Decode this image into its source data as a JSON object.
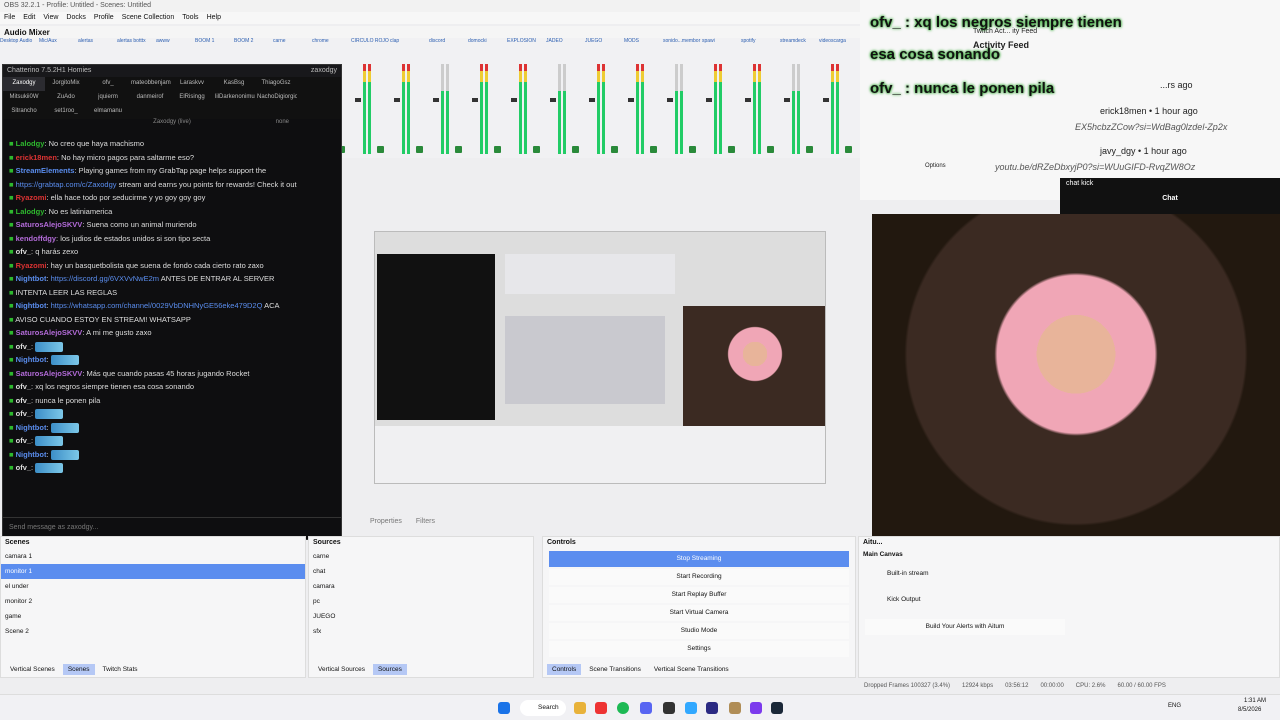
{
  "window": {
    "title": "OBS 32.2.1 - Profile: Untitled - Scenes: Untitled"
  },
  "menu": [
    "File",
    "Edit",
    "View",
    "Docks",
    "Profile",
    "Scene Collection",
    "Tools",
    "Help"
  ],
  "mixer": {
    "title": "Audio Mixer",
    "channels": [
      "Desktop Audio",
      "Mic/Aux",
      "alertas",
      "alertas botttx",
      "awww",
      "BOOM 1",
      "BOOM 2",
      "carne",
      "chrome",
      "CIRCULO ROJO",
      "clap",
      "discord",
      "domocki",
      "EXPLOSION",
      "JADEO",
      "JUEGO",
      "MODS",
      "sonido...membor",
      "spawi",
      "spotify",
      "streamdeck",
      "videoscarga"
    ]
  },
  "chat": {
    "window_title": "Chatterino 7.5.2H1 Homies",
    "channel": "zaxodgy",
    "tabs_row1": [
      "Zaxodgy",
      "JorgitoMix",
      "ofv_",
      "mateobbenjamin",
      "Laraskvv",
      "KasBsg",
      "ThiagoGsz"
    ],
    "tabs_row2": [
      "Mitsukii0W",
      "ZuAdo",
      "jquierm",
      "danmeirof",
      "ElRisingg",
      "lilDarkenonimual",
      "NachoDigiorgio"
    ],
    "tabs_row3": [
      "Sitrancho",
      "set1roo_",
      "elmamanu"
    ],
    "live_label": "Zaxodgy (live)",
    "none_label": "none",
    "messages": [
      {
        "user": "Lalodgy",
        "color": "#2eb82e",
        "text": "No creo que haya machismo"
      },
      {
        "user": "erick18men",
        "color": "#d33",
        "text": "No hay micro pagos para saltarme eso?"
      },
      {
        "user": "StreamElements",
        "color": "#5a8dee",
        "text": "Playing games from my GrabTap page helps support the"
      },
      {
        "user": "",
        "color": "#ddd",
        "text": "stream and earns you points for rewards! Check it out",
        "link": "https://grabtap.com/c/Zaxodgy"
      },
      {
        "user": "Ryazomi",
        "color": "#d33",
        "text": "ella hace todo por seducirme y yo goy goy goy"
      },
      {
        "user": "Lalodgy",
        "color": "#2eb82e",
        "text": "No es latiniamerica"
      },
      {
        "user": "SaturosAlejoSKVV",
        "color": "#b36bd9",
        "text": "Suena como un animal muriendo"
      },
      {
        "user": "kendoffdgy",
        "color": "#b36bd9",
        "text": "los judios de estados unidos si son tipo secta"
      },
      {
        "user": "ofv_",
        "color": "#ddd",
        "text": "q harás zexo"
      },
      {
        "user": "Ryazomi",
        "color": "#d33",
        "text": "hay un basquetbolista que suena de fondo cada cierto rato zaxo"
      },
      {
        "user": "Nightbot",
        "color": "#5a8dee",
        "text": "ANTES DE ENTRAR AL SERVER",
        "link": "https://discord.gg/6VXVvNwE2m"
      },
      {
        "user": "",
        "color": "#ddd",
        "text": "INTENTA LEER LAS REGLAS"
      },
      {
        "user": "Nightbot",
        "color": "#5a8dee",
        "text": "ACA",
        "link": "https://whatsapp.com/channel/0029VbDNHNyGE56eke479D2Q"
      },
      {
        "user": "",
        "color": "#ddd",
        "text": "AVISO CUANDO ESTOY EN STREAM! WHATSAPP"
      },
      {
        "user": "SaturosAlejoSKVV",
        "color": "#b36bd9",
        "text": "A mi me gusto zaxo"
      },
      {
        "user": "ofv_",
        "color": "#ddd",
        "text": "",
        "emote": true
      },
      {
        "user": "Nightbot",
        "color": "#5a8dee",
        "text": "",
        "emote": true
      },
      {
        "user": "SaturosAlejoSKVV",
        "color": "#b36bd9",
        "text": "Más que cuando pasas 45 horas jugando Rocket"
      },
      {
        "user": "ofv_",
        "color": "#ddd",
        "text": "xq los negros siempre tienen esa cosa sonando"
      },
      {
        "user": "ofv_",
        "color": "#ddd",
        "text": "nunca le ponen pila"
      },
      {
        "user": "ofv_",
        "color": "#ddd",
        "text": "",
        "emote": true
      },
      {
        "user": "Nightbot",
        "color": "#5a8dee",
        "text": "",
        "emote": true
      },
      {
        "user": "ofv_",
        "color": "#ddd",
        "text": "",
        "emote": true
      },
      {
        "user": "Nightbot",
        "color": "#5a8dee",
        "text": "",
        "emote": true
      },
      {
        "user": "ofv_",
        "color": "#ddd",
        "text": "",
        "emote": true
      }
    ],
    "input_placeholder": "Send message as zaxodgy..."
  },
  "overlay": {
    "line1": "ofv_ : xq los negros siempre tienen",
    "line2": "esa cosa sonando",
    "line3": "ofv_ : nunca le ponen pila",
    "activity_feed": "Activity Feed",
    "twitch_feed": "Twitch Act... ity Feed",
    "feed1": "erick18men • 1 hour ago",
    "feed2": "javy_dgy • 1 hour ago",
    "feed3": "EX5hcbzZCow?si=WdBag0lzdel-Zp2x",
    "feed4": "youtu.be/dRZeDbxyjP0?si=WUuGIFD-RvqZW8Oz",
    "ago": "...rs ago",
    "options": "Options"
  },
  "kick": {
    "title": "chat kick",
    "label": "Chat"
  },
  "props": {
    "properties": "Properties",
    "filters": "Filters"
  },
  "scenes": {
    "title": "Scenes",
    "items": [
      "camara 1",
      "monitor 1",
      "el under",
      "monitor 2",
      "game",
      "Scene 2"
    ],
    "selected": 1,
    "tabs": [
      "Vertical Scenes",
      "Scenes",
      "Twitch Stats"
    ]
  },
  "sources": {
    "title": "Sources",
    "items": [
      "carne",
      "chat",
      "camara",
      "pc",
      "JUEGO",
      "sfx"
    ],
    "tabs": [
      "Vertical Sources",
      "Sources"
    ]
  },
  "controls": {
    "title": "Controls",
    "buttons": [
      "Stop Streaming",
      "Start Recording",
      "Start Replay Buffer",
      "Start Virtual Camera",
      "Studio Mode",
      "Settings"
    ],
    "tabs": [
      "Controls",
      "Scene Transitions",
      "Vertical Scene Transitions"
    ]
  },
  "aitum": {
    "title": "Aitu...",
    "canvas": "Main Canvas",
    "outputs": [
      "Built-in stream",
      "Kick Output"
    ],
    "build": "Build Your Alerts with Aitum"
  },
  "status": {
    "dropped": "Dropped Frames 100327 (3.4%)",
    "kbps": "12924 kbps",
    "time1": "03:56:12",
    "time2": "00:00:00",
    "cpu": "CPU: 2.6%",
    "fps": "60.00 / 60.00 FPS"
  },
  "taskbar": {
    "search": "Search",
    "lang": "ENG",
    "time": "1:31 AM",
    "date": "8/5/2026"
  }
}
